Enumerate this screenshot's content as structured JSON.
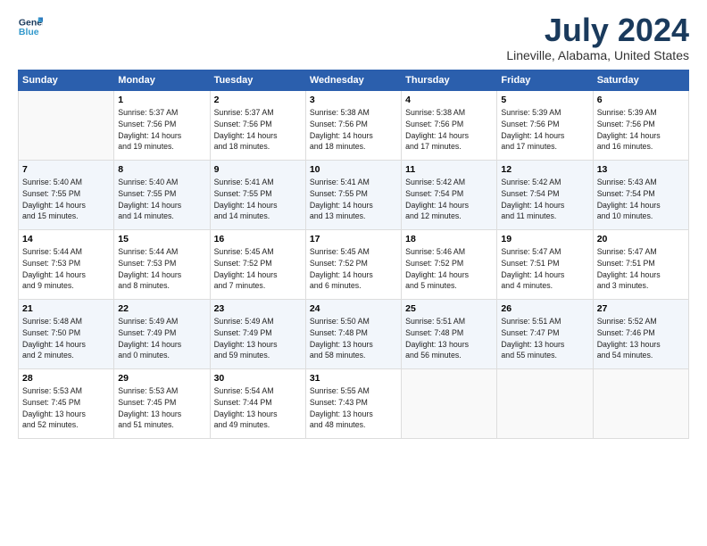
{
  "header": {
    "logo_line1": "General",
    "logo_line2": "Blue",
    "month_title": "July 2024",
    "location": "Lineville, Alabama, United States"
  },
  "weekdays": [
    "Sunday",
    "Monday",
    "Tuesday",
    "Wednesday",
    "Thursday",
    "Friday",
    "Saturday"
  ],
  "weeks": [
    [
      {
        "day": "",
        "info": ""
      },
      {
        "day": "1",
        "info": "Sunrise: 5:37 AM\nSunset: 7:56 PM\nDaylight: 14 hours\nand 19 minutes."
      },
      {
        "day": "2",
        "info": "Sunrise: 5:37 AM\nSunset: 7:56 PM\nDaylight: 14 hours\nand 18 minutes."
      },
      {
        "day": "3",
        "info": "Sunrise: 5:38 AM\nSunset: 7:56 PM\nDaylight: 14 hours\nand 18 minutes."
      },
      {
        "day": "4",
        "info": "Sunrise: 5:38 AM\nSunset: 7:56 PM\nDaylight: 14 hours\nand 17 minutes."
      },
      {
        "day": "5",
        "info": "Sunrise: 5:39 AM\nSunset: 7:56 PM\nDaylight: 14 hours\nand 17 minutes."
      },
      {
        "day": "6",
        "info": "Sunrise: 5:39 AM\nSunset: 7:56 PM\nDaylight: 14 hours\nand 16 minutes."
      }
    ],
    [
      {
        "day": "7",
        "info": "Sunrise: 5:40 AM\nSunset: 7:55 PM\nDaylight: 14 hours\nand 15 minutes."
      },
      {
        "day": "8",
        "info": "Sunrise: 5:40 AM\nSunset: 7:55 PM\nDaylight: 14 hours\nand 14 minutes."
      },
      {
        "day": "9",
        "info": "Sunrise: 5:41 AM\nSunset: 7:55 PM\nDaylight: 14 hours\nand 14 minutes."
      },
      {
        "day": "10",
        "info": "Sunrise: 5:41 AM\nSunset: 7:55 PM\nDaylight: 14 hours\nand 13 minutes."
      },
      {
        "day": "11",
        "info": "Sunrise: 5:42 AM\nSunset: 7:54 PM\nDaylight: 14 hours\nand 12 minutes."
      },
      {
        "day": "12",
        "info": "Sunrise: 5:42 AM\nSunset: 7:54 PM\nDaylight: 14 hours\nand 11 minutes."
      },
      {
        "day": "13",
        "info": "Sunrise: 5:43 AM\nSunset: 7:54 PM\nDaylight: 14 hours\nand 10 minutes."
      }
    ],
    [
      {
        "day": "14",
        "info": "Sunrise: 5:44 AM\nSunset: 7:53 PM\nDaylight: 14 hours\nand 9 minutes."
      },
      {
        "day": "15",
        "info": "Sunrise: 5:44 AM\nSunset: 7:53 PM\nDaylight: 14 hours\nand 8 minutes."
      },
      {
        "day": "16",
        "info": "Sunrise: 5:45 AM\nSunset: 7:52 PM\nDaylight: 14 hours\nand 7 minutes."
      },
      {
        "day": "17",
        "info": "Sunrise: 5:45 AM\nSunset: 7:52 PM\nDaylight: 14 hours\nand 6 minutes."
      },
      {
        "day": "18",
        "info": "Sunrise: 5:46 AM\nSunset: 7:52 PM\nDaylight: 14 hours\nand 5 minutes."
      },
      {
        "day": "19",
        "info": "Sunrise: 5:47 AM\nSunset: 7:51 PM\nDaylight: 14 hours\nand 4 minutes."
      },
      {
        "day": "20",
        "info": "Sunrise: 5:47 AM\nSunset: 7:51 PM\nDaylight: 14 hours\nand 3 minutes."
      }
    ],
    [
      {
        "day": "21",
        "info": "Sunrise: 5:48 AM\nSunset: 7:50 PM\nDaylight: 14 hours\nand 2 minutes."
      },
      {
        "day": "22",
        "info": "Sunrise: 5:49 AM\nSunset: 7:49 PM\nDaylight: 14 hours\nand 0 minutes."
      },
      {
        "day": "23",
        "info": "Sunrise: 5:49 AM\nSunset: 7:49 PM\nDaylight: 13 hours\nand 59 minutes."
      },
      {
        "day": "24",
        "info": "Sunrise: 5:50 AM\nSunset: 7:48 PM\nDaylight: 13 hours\nand 58 minutes."
      },
      {
        "day": "25",
        "info": "Sunrise: 5:51 AM\nSunset: 7:48 PM\nDaylight: 13 hours\nand 56 minutes."
      },
      {
        "day": "26",
        "info": "Sunrise: 5:51 AM\nSunset: 7:47 PM\nDaylight: 13 hours\nand 55 minutes."
      },
      {
        "day": "27",
        "info": "Sunrise: 5:52 AM\nSunset: 7:46 PM\nDaylight: 13 hours\nand 54 minutes."
      }
    ],
    [
      {
        "day": "28",
        "info": "Sunrise: 5:53 AM\nSunset: 7:45 PM\nDaylight: 13 hours\nand 52 minutes."
      },
      {
        "day": "29",
        "info": "Sunrise: 5:53 AM\nSunset: 7:45 PM\nDaylight: 13 hours\nand 51 minutes."
      },
      {
        "day": "30",
        "info": "Sunrise: 5:54 AM\nSunset: 7:44 PM\nDaylight: 13 hours\nand 49 minutes."
      },
      {
        "day": "31",
        "info": "Sunrise: 5:55 AM\nSunset: 7:43 PM\nDaylight: 13 hours\nand 48 minutes."
      },
      {
        "day": "",
        "info": ""
      },
      {
        "day": "",
        "info": ""
      },
      {
        "day": "",
        "info": ""
      }
    ]
  ]
}
